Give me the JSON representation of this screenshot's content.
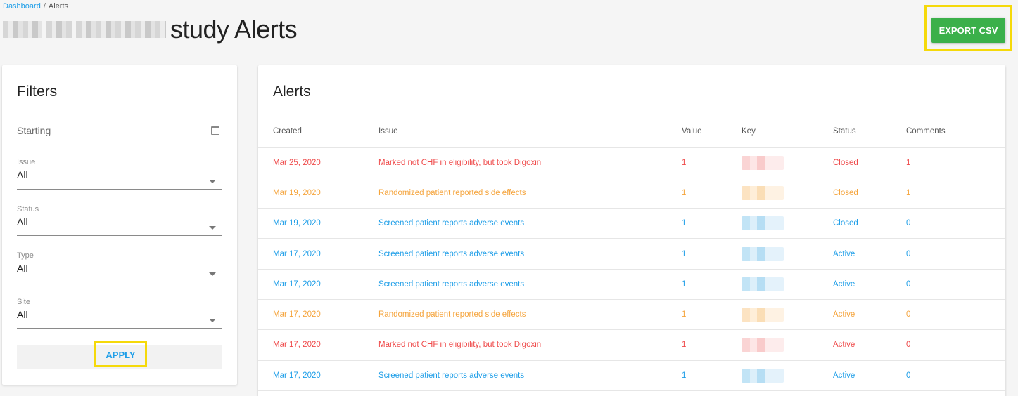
{
  "breadcrumb": {
    "home": "Dashboard",
    "separator": "/",
    "current": "Alerts"
  },
  "header": {
    "title": "study Alerts",
    "export_label": "EXPORT CSV"
  },
  "filters": {
    "title": "Filters",
    "starting": {
      "placeholder": "Starting"
    },
    "issue": {
      "label": "Issue",
      "value": "All"
    },
    "status": {
      "label": "Status",
      "value": "All"
    },
    "type": {
      "label": "Type",
      "value": "All"
    },
    "site": {
      "label": "Site",
      "value": "All"
    },
    "apply_label": "APPLY"
  },
  "alerts": {
    "title": "Alerts",
    "columns": [
      "Created",
      "Issue",
      "Value",
      "Key",
      "Status",
      "Comments"
    ],
    "rows": [
      {
        "created": "Mar 25, 2020",
        "issue": "Marked not CHF in eligibility, but took Digoxin",
        "value": "1",
        "status": "Closed",
        "comments": "1",
        "color": "red"
      },
      {
        "created": "Mar 19, 2020",
        "issue": "Randomized patient reported side effects",
        "value": "1",
        "status": "Closed",
        "comments": "1",
        "color": "orange"
      },
      {
        "created": "Mar 19, 2020",
        "issue": "Screened patient reports adverse events",
        "value": "1",
        "status": "Closed",
        "comments": "0",
        "color": "blue"
      },
      {
        "created": "Mar 17, 2020",
        "issue": "Screened patient reports adverse events",
        "value": "1",
        "status": "Active",
        "comments": "0",
        "color": "blue"
      },
      {
        "created": "Mar 17, 2020",
        "issue": "Screened patient reports adverse events",
        "value": "1",
        "status": "Active",
        "comments": "0",
        "color": "blue"
      },
      {
        "created": "Mar 17, 2020",
        "issue": "Randomized patient reported side effects",
        "value": "1",
        "status": "Active",
        "comments": "0",
        "color": "orange"
      },
      {
        "created": "Mar 17, 2020",
        "issue": "Marked not CHF in eligibility, but took Digoxin",
        "value": "1",
        "status": "Active",
        "comments": "0",
        "color": "red"
      },
      {
        "created": "Mar 17, 2020",
        "issue": "Screened patient reports adverse events",
        "value": "1",
        "status": "Active",
        "comments": "0",
        "color": "blue"
      }
    ]
  },
  "colors": {
    "accent": "#1e9ee8",
    "export_button": "#3bb04a",
    "highlight": "#f5d90a",
    "red": "#ef4b4b",
    "orange": "#f5a43c",
    "blue": "#1e9ee8"
  }
}
